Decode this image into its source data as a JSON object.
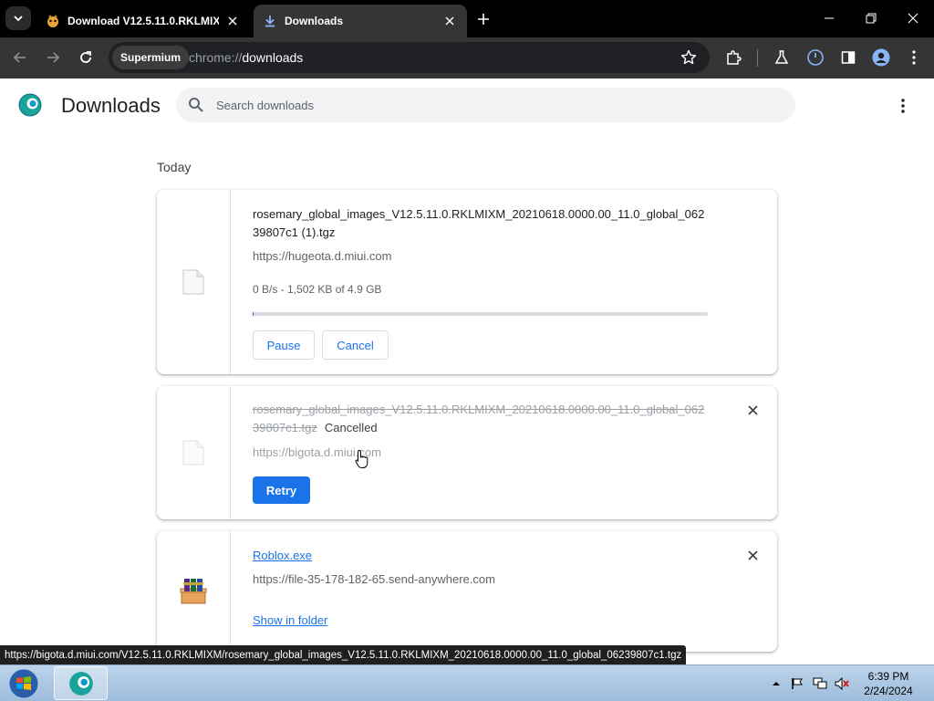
{
  "browser": {
    "tabs": [
      {
        "title": "Download V12.5.11.0.RKLMIXM",
        "active": false
      },
      {
        "title": "Downloads",
        "active": true
      }
    ],
    "site_chip": "Supermium",
    "url_scheme": "chrome://",
    "url_path": "downloads"
  },
  "page": {
    "title": "Downloads",
    "search_placeholder": "Search downloads",
    "section_date": "Today"
  },
  "downloads": [
    {
      "file_name": "rosemary_global_images_V12.5.11.0.RKLMIXM_20210618.0000.00_11.0_global_06239807c1 (1).tgz",
      "url": "https://hugeota.d.miui.com",
      "progress_text": "0 B/s - 1,502 KB of 4.9 GB",
      "progress_fraction": 0.0003,
      "pause_label": "Pause",
      "cancel_label": "Cancel"
    },
    {
      "file_name": "rosemary_global_images_V12.5.11.0.RKLMIXM_20210618.0000.00_11.0_global_06239807c1.tgz",
      "status": "Cancelled",
      "url": "https://bigota.d.miui.com",
      "retry_label": "Retry"
    },
    {
      "file_name": "Roblox.exe",
      "url": "https://file-35-178-182-65.send-anywhere.com",
      "show_in_folder_label": "Show in folder"
    }
  ],
  "status_bubble": "https://bigota.d.miui.com/V12.5.11.0.RKLMIXM/rosemary_global_images_V12.5.11.0.RKLMIXM_20210618.0000.00_11.0_global_06239807c1.tgz",
  "taskbar": {
    "time": "6:39 PM",
    "date": "2/24/2024"
  },
  "colors": {
    "accent": "#1a73e8",
    "titlebar": "#000000",
    "toolbar": "#353535"
  }
}
